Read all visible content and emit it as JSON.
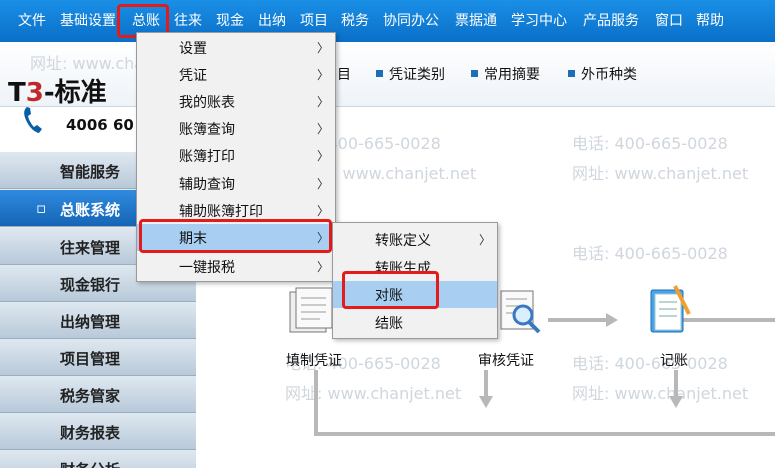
{
  "menubar": {
    "items": [
      "文件",
      "基础设置",
      "总账",
      "往来",
      "现金",
      "出纳",
      "项目",
      "税务",
      "协同办公",
      "票据通",
      "学习中心",
      "产品服务",
      "窗口",
      "帮助"
    ]
  },
  "logo": {
    "brand_prefix": "T",
    "brand_num": "3",
    "brand_suffix": "-标准"
  },
  "phone": {
    "number": "4006 60"
  },
  "toolbar": {
    "items": [
      "目",
      "凭证类别",
      "常用摘要",
      "外币种类"
    ]
  },
  "watermark": {
    "phone": "电话: 400-665-0028",
    "site": "网址: www.chanjet.net"
  },
  "sidebar": {
    "items": [
      "智能服务",
      "总账系统",
      "往来管理",
      "现金银行",
      "出纳管理",
      "项目管理",
      "税务管家",
      "财务报表",
      "财务分析"
    ],
    "active_bullet": "▫"
  },
  "menu_gl": {
    "items": [
      "设置",
      "凭证",
      "我的账表",
      "账簿查询",
      "账簿打印",
      "辅助查询",
      "辅助账簿打印",
      "期末",
      "一键报税"
    ],
    "highlighted": "期末"
  },
  "menu_period_end": {
    "items": [
      "转账定义",
      "转账生成",
      "对账",
      "结账"
    ],
    "highlighted": "对账"
  },
  "flow": {
    "fill_voucher": "填制凭证",
    "audit_voucher": "审核凭证",
    "post": "记账"
  },
  "colors": {
    "menubar": "#0a7ad4",
    "highlight": "#a8cff2",
    "annotation": "#e31b1b"
  }
}
